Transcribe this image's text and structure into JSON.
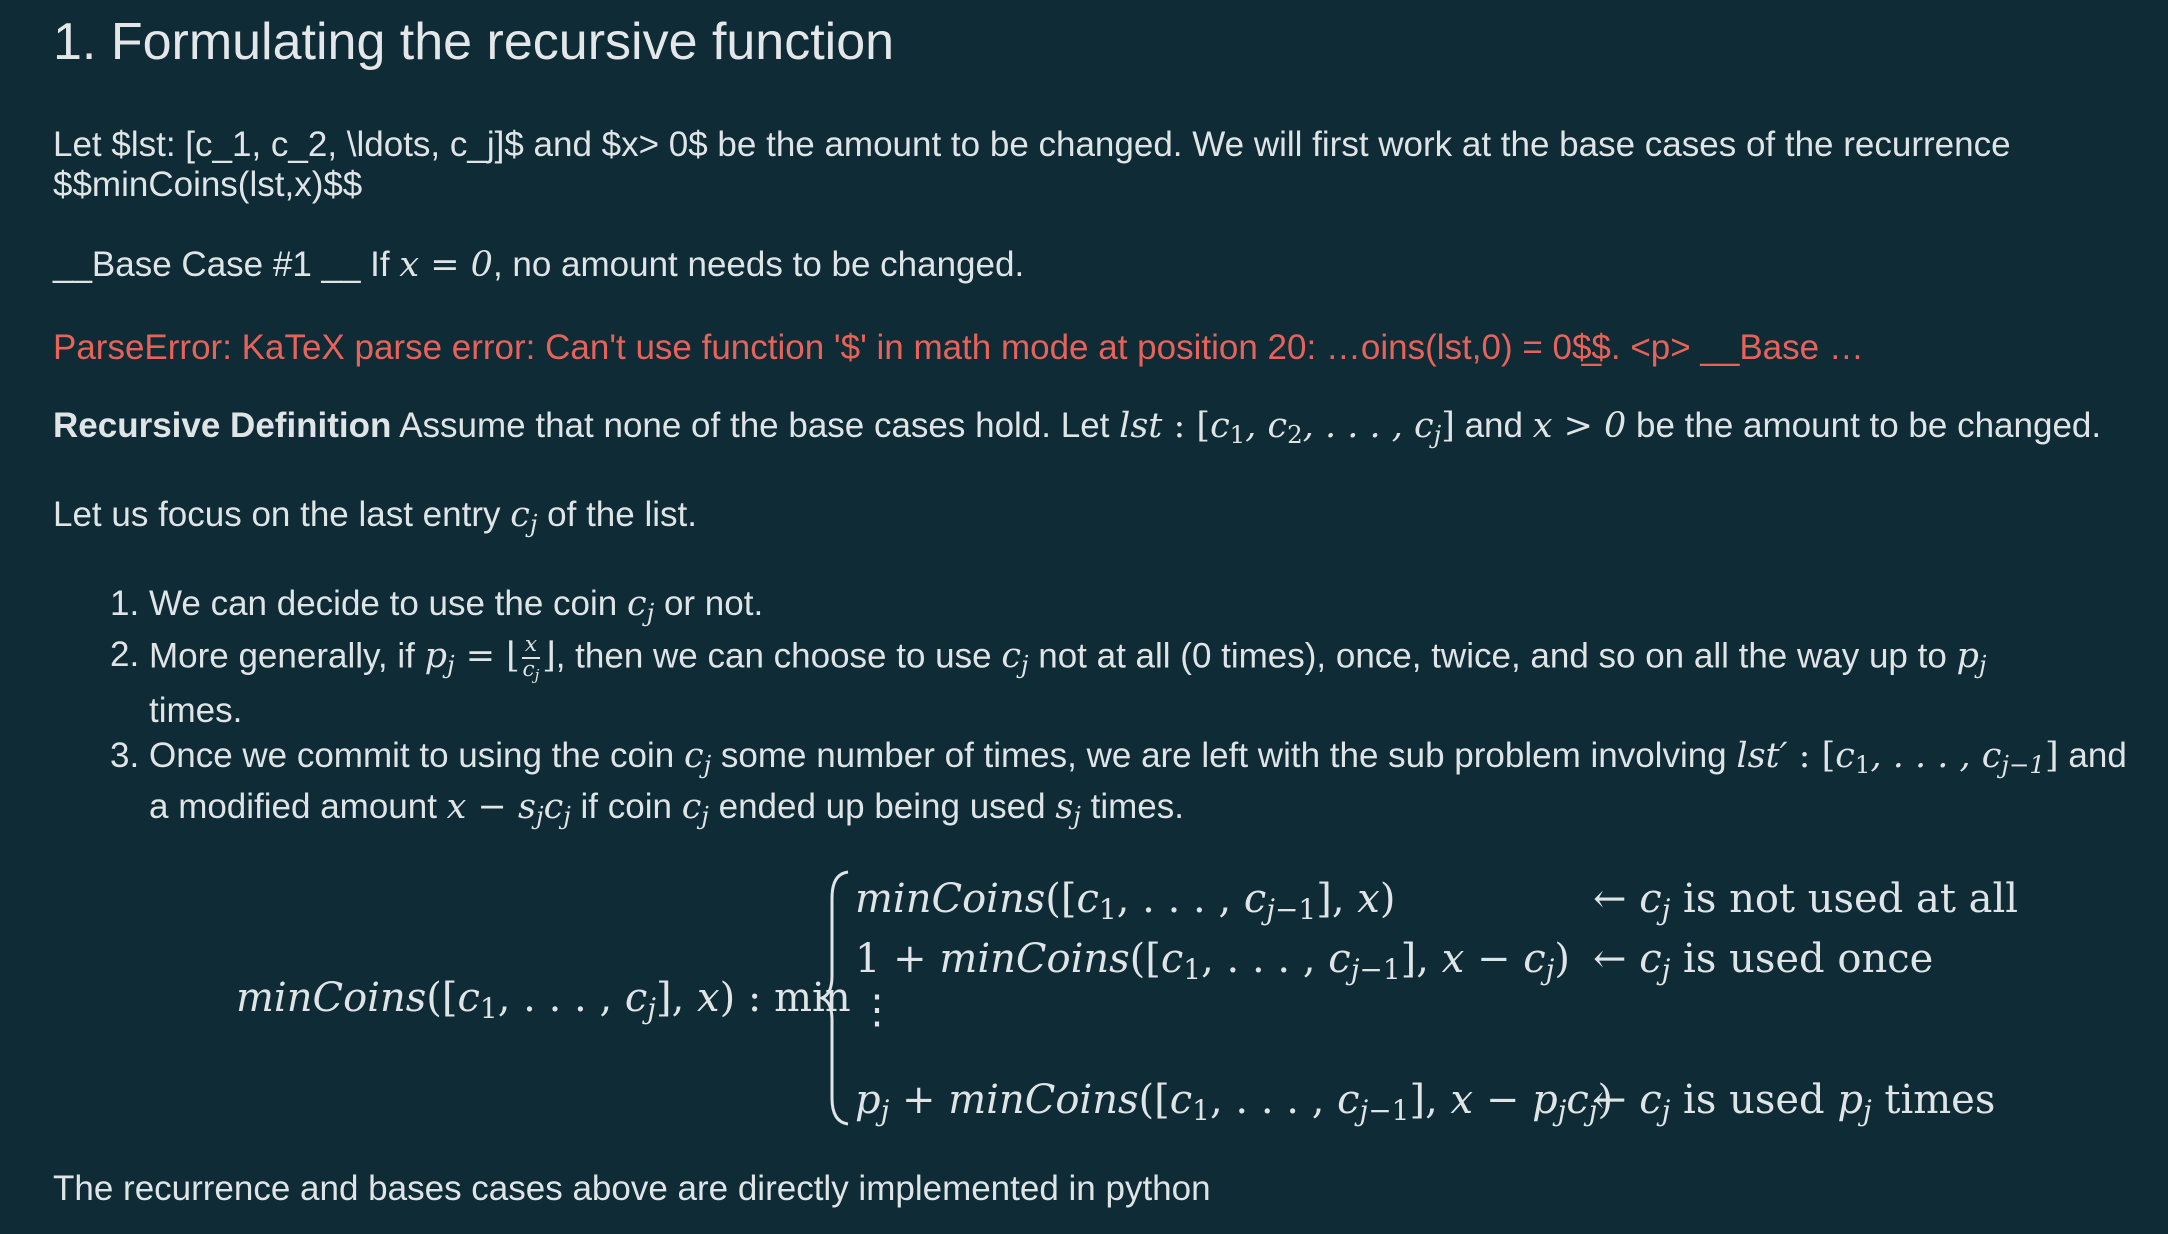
{
  "heading": "1. Formulating the recursive function",
  "intro": {
    "line1": "Let $lst: [c_1, c_2, \\ldots, c_j]$ and $x> 0$ be the amount to be changed. We will first work at the base cases of the recurrence",
    "line2": "$$minCoins(lst,x)$$"
  },
  "base_case": {
    "prefix": "__Base Case #1 __ If ",
    "math": "x = 0",
    "suffix": ", no amount needs to be changed."
  },
  "parse_error": "ParseError: KaTeX parse error: Can't use function '$' in math mode at position 20: …oins(lst,0) = 0$̲$. <p> __Base …",
  "recursive_def": {
    "bold": "Recursive Definition",
    "text1": " Assume that none of the base cases hold. Let ",
    "math1": "lst : [c",
    "text2": " and ",
    "math2": "x > 0",
    "text3": " be the amount to be changed."
  },
  "focus": {
    "text1": "Let us focus on the last entry ",
    "text2": " of the list."
  },
  "list": [
    {
      "num": "1.",
      "text_a": "We can decide to use the coin ",
      "text_b": " or not."
    },
    {
      "num": "2.",
      "text_a": "More generally, if ",
      "text_b": ", then we can choose to use ",
      "text_c": " not at all (0 times), once, twice, and so on all the way up to ",
      "text_d": "times."
    },
    {
      "num": "3.",
      "text_a": "Once we commit to using the coin ",
      "text_b": " some number of times, we are left with the sub problem involving ",
      "text_c": " and",
      "text_d": "a modified amount ",
      "text_e": " if coin ",
      "text_f": " ended up being used ",
      "text_g": " times."
    }
  ],
  "equation": {
    "lhs": "minCoins([c₁, . . . , cⱼ], x) :  min",
    "cases": [
      {
        "expr": "minCoins([c₁, . . . , cⱼ₋₁], x)",
        "note": "← cⱼ is not used at all"
      },
      {
        "expr": "1 + minCoins([c₁, . . . , cⱼ₋₁], x − cⱼ)",
        "note": "← cⱼ is used once"
      },
      {
        "expr": "⋮",
        "note": ""
      },
      {
        "expr": "pⱼ + minCoins([c₁, . . . , cⱼ₋₁], x − pⱼcⱼ)",
        "note": "← cⱼ is used pⱼ times"
      }
    ]
  },
  "footer": "The recurrence and bases cases above are directly implemented in python"
}
